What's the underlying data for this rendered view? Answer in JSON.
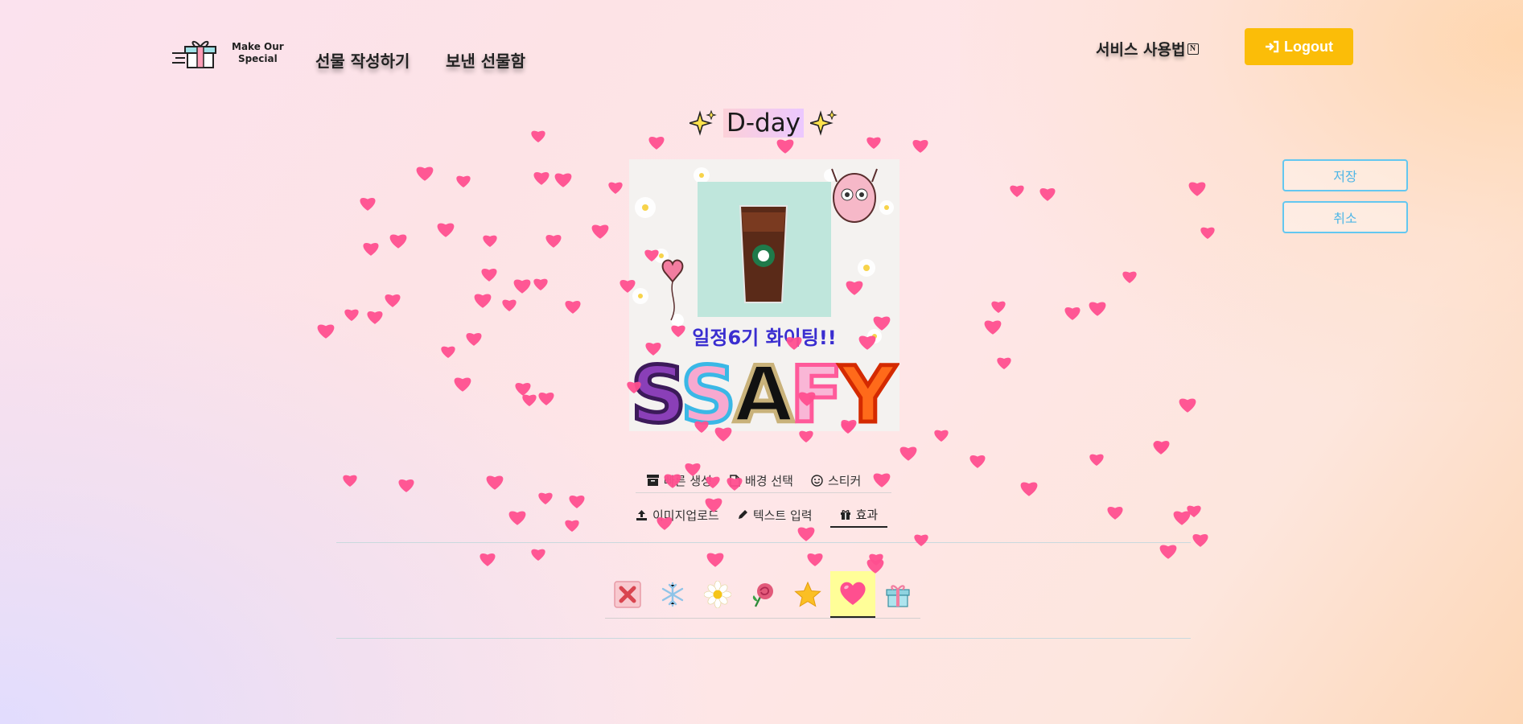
{
  "header": {
    "logo_line1": "Make Our",
    "logo_line2": "Special",
    "nav_write": "선물 작성하기",
    "nav_sent": "보낸 선물함",
    "howto": "서비스 사용법",
    "logout": "Logout"
  },
  "title": "D-day",
  "actions": {
    "save": "저장",
    "cancel": "취소"
  },
  "card": {
    "message": "일정6기 화이팅!!",
    "letters": [
      "S",
      "S",
      "A",
      "F",
      "Y"
    ]
  },
  "menu": {
    "row1": [
      {
        "icon": "archive-icon",
        "label": "빠른 생성"
      },
      {
        "icon": "file-icon",
        "label": "배경 선택"
      },
      {
        "icon": "smile-icon",
        "label": "스티커"
      }
    ],
    "row2": [
      {
        "icon": "upload-icon",
        "label": "이미지업로드"
      },
      {
        "icon": "pencil-icon",
        "label": "텍스트 입력"
      },
      {
        "icon": "gift-icon",
        "label": "효과"
      }
    ],
    "active": "효과"
  },
  "effects": [
    {
      "name": "none",
      "icon": "x-icon"
    },
    {
      "name": "snow",
      "icon": "snowflake-icon"
    },
    {
      "name": "daisy",
      "icon": "daisy-icon"
    },
    {
      "name": "rose",
      "icon": "rose-icon"
    },
    {
      "name": "star",
      "icon": "star-icon"
    },
    {
      "name": "heart",
      "icon": "heart-icon"
    },
    {
      "name": "gift",
      "icon": "gift-box-icon"
    }
  ],
  "selected_effect": "heart",
  "colors": {
    "logout": "#fbbd08",
    "outline_button": "#63c7f0",
    "heart": "#ff4f8f",
    "card_text": "#3a2ed0",
    "selected_effect": "#fffe98"
  }
}
